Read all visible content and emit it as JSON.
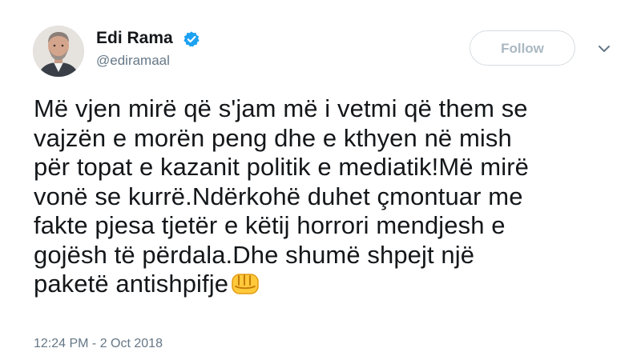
{
  "author": {
    "name": "Edi Rama",
    "handle": "@ediramaal",
    "verified_icon": "verified-badge-icon",
    "avatar_icon": "profile-photo"
  },
  "actions": {
    "follow_label": "Follow",
    "menu_icon": "chevron-down-icon"
  },
  "tweet": {
    "text": "Më vjen mirë që s'jam më i vetmi që them se\nvajzën e morën peng dhe e kthyen në mish\npër topat e kazanit politik e mediatik!Më mirë\nvonë se kurrë.Ndërkohë duhet çmontuar me\nfakte pjesa tjetër e këtij horrori mendjesh e\ngojësh të përdala.Dhe shumë shpejt një\npaketë antishpifje",
    "emoji_icon": "raised-fist-emoji-icon",
    "timestamp": "12:24 PM - 2 Oct 2018"
  },
  "colors": {
    "text": "#14171a",
    "secondary": "#657786",
    "verified": "#1da1f2",
    "follow_border": "#d8dde1",
    "follow_text": "#aab8c2",
    "emoji": "#ffc93a"
  }
}
